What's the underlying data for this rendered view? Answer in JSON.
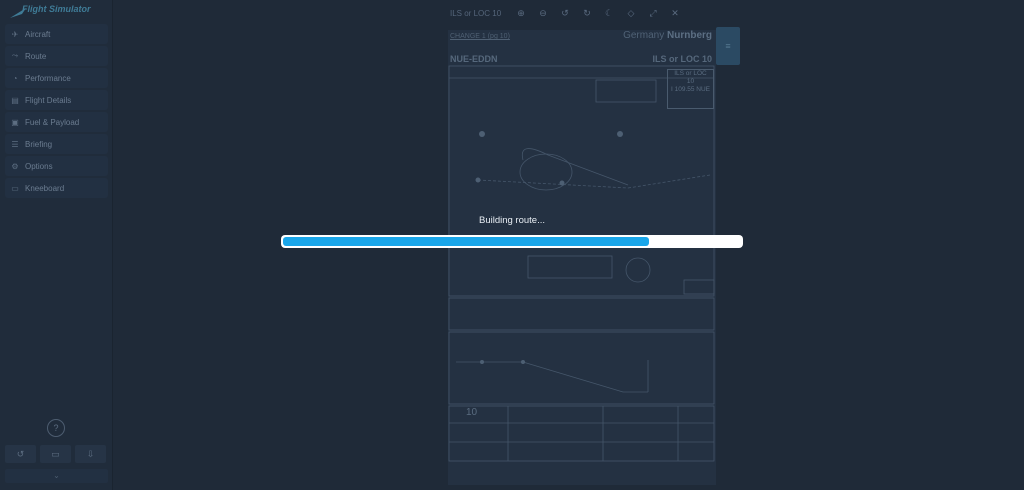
{
  "sidebar": {
    "logo_text": "Flight Simulator",
    "items": [
      {
        "label": "Aircraft",
        "icon": "plane-icon"
      },
      {
        "label": "Route",
        "icon": "route-icon"
      },
      {
        "label": "Performance",
        "icon": "gauge-icon"
      },
      {
        "label": "Flight Details",
        "icon": "details-icon"
      },
      {
        "label": "Fuel & Payload",
        "icon": "fuel-icon"
      },
      {
        "label": "Briefing",
        "icon": "briefing-icon"
      },
      {
        "label": "Options",
        "icon": "options-icon"
      },
      {
        "label": "Kneeboard",
        "icon": "kneeboard-icon"
      }
    ],
    "help_label": "?"
  },
  "viewer": {
    "title": "ILS or LOC 10",
    "toolbar_icons": [
      "zoom-in-icon",
      "zoom-out-icon",
      "rotate-ccw-icon",
      "rotate-cw-icon",
      "night-mode-icon",
      "pin-icon",
      "fullscreen-icon",
      "close-icon"
    ]
  },
  "chart": {
    "header_left": "CHANGE 1 (pg 10)",
    "country": "Germany",
    "city": "Nurnberg",
    "airport_id": "NUE-EDDN",
    "procedure": "ILS or LOC 10",
    "ils_box_line1": "ILS or LOC",
    "ils_box_line2": "10",
    "ils_box_line3": "I 109.55 NUE",
    "runway_number": "10"
  },
  "loading": {
    "label": "Building route...",
    "progress": 0.8
  },
  "colors": {
    "background": "#1f2a38",
    "progress_fill": "#19a6ea",
    "progress_track": "#ffffff"
  }
}
